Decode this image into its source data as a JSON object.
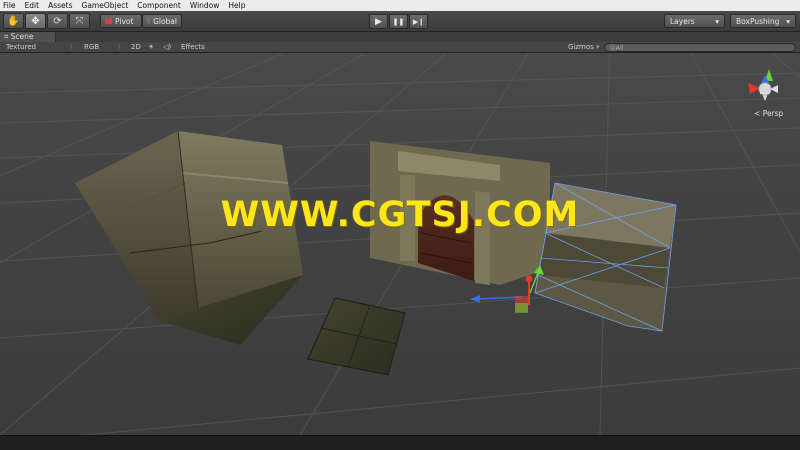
{
  "menu": [
    "File",
    "Edit",
    "Assets",
    "GameObject",
    "Component",
    "Window",
    "Help"
  ],
  "toolbar": {
    "tools": [
      {
        "name": "hand-tool-icon",
        "glyph": "✋"
      },
      {
        "name": "move-tool-icon",
        "glyph": "✥"
      },
      {
        "name": "rotate-tool-icon",
        "glyph": "⟳"
      },
      {
        "name": "scale-tool-icon",
        "glyph": "⤧"
      }
    ],
    "pivot_label": "Pivot",
    "global_label": "Global",
    "play_glyph": "▶",
    "pause_glyph": "❚❚",
    "step_glyph": "▶❙",
    "layers_label": "Layers",
    "layout_label": "BoxPushing"
  },
  "scene_tab": {
    "label": "Scene",
    "icon": "scene-icon"
  },
  "scene_bar": {
    "render_mode": "Textured",
    "color_mode": "RGB",
    "mode_2d": "2D",
    "effects_label": "Effects",
    "gizmos_label": "Gizmos",
    "search_placeholder": "ⓆAll"
  },
  "viewport": {
    "watermark": "WWW.CGTSJ.COM",
    "projection_label": "Persp"
  },
  "colors": {
    "watermark": "#ffe619",
    "axis_x": "#e23b2e",
    "axis_y": "#6ad13b",
    "axis_z": "#3b6ee0",
    "selection": "#6fa8ff"
  }
}
